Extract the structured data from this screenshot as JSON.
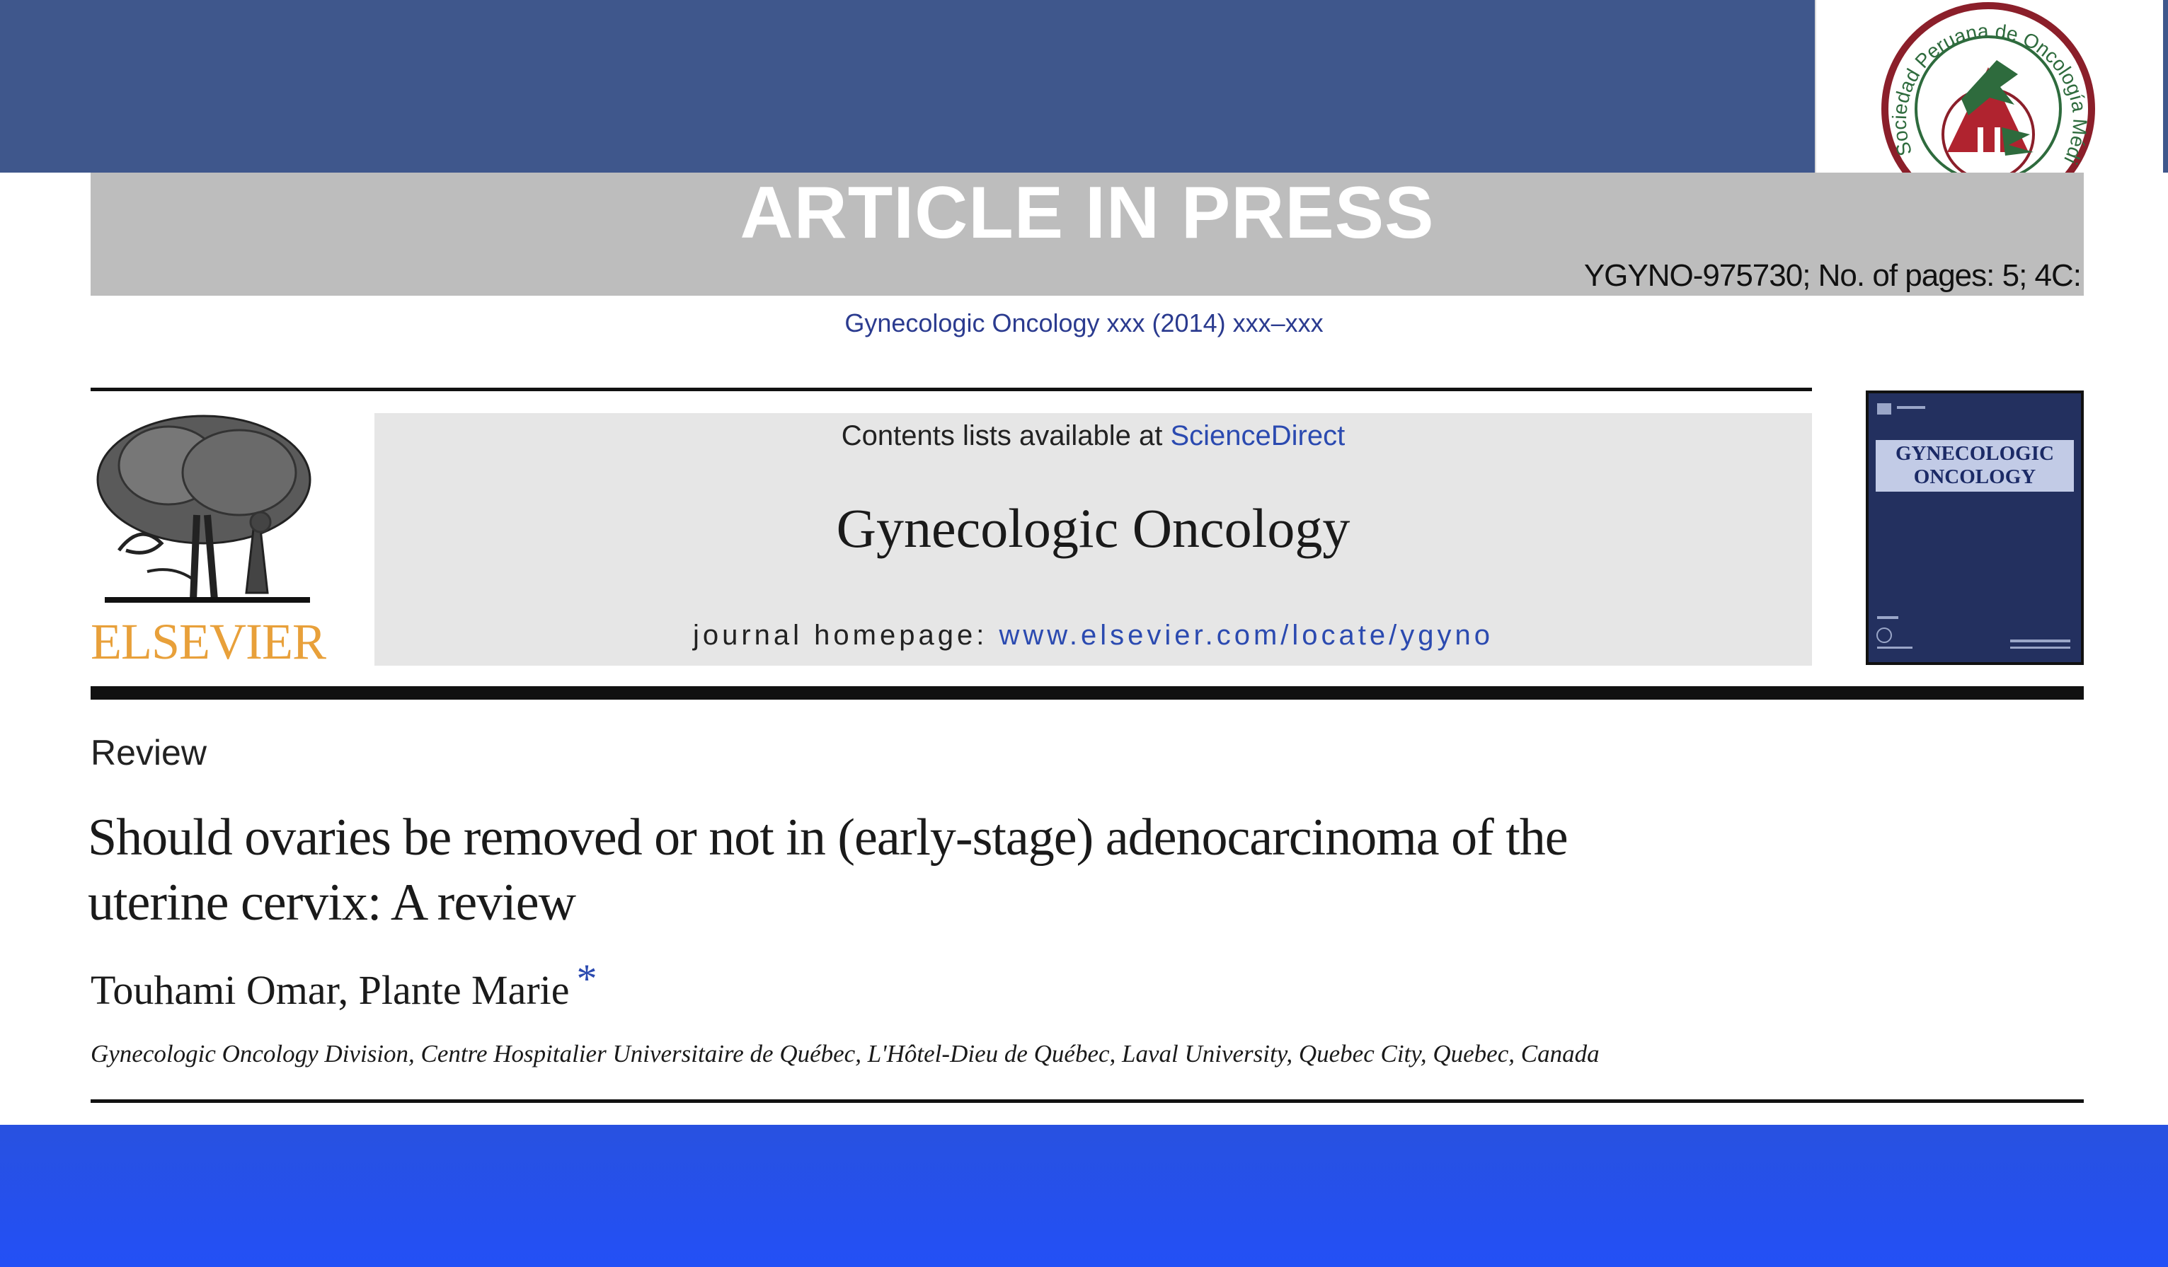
{
  "article_in_press": {
    "title": "ARTICLE IN PRESS",
    "reference": "YGYNO-975730; No. of pages: 5; 4C:"
  },
  "journal_ref": "Gynecologic Oncology xxx (2014) xxx–xxx",
  "society_logo": {
    "text": "Sociedad Peruana de Oncología Médica",
    "icon": "society-seal-icon"
  },
  "publisher": {
    "name": "ELSEVIER",
    "icon": "elsevier-tree-icon"
  },
  "masthead": {
    "contents_prefix": "Contents lists available at ",
    "contents_link": "ScienceDirect",
    "journal_title": "Gynecologic Oncology",
    "homepage_prefix": "journal homepage: ",
    "homepage_url": "www.elsevier.com/locate/ygyno"
  },
  "cover": {
    "title_line1": "GYNECOLOGIC",
    "title_line2": "ONCOLOGY"
  },
  "article": {
    "type": "Review",
    "title_line1": "Should ovaries be removed or not in (early-stage) adenocarcinoma of the",
    "title_line2": "uterine cervix: A review",
    "authors": "Touhami Omar, Plante Marie",
    "corresponding_mark": "*",
    "affiliation": "Gynecologic Oncology Division, Centre Hospitalier Universitaire de Québec, L'Hôtel-Dieu de Québec, Laval University, Quebec City, Quebec, Canada"
  },
  "colors": {
    "top_bar": "#3f578c",
    "bottom_bar": "#2350f6",
    "link_blue": "#2b4ab0",
    "elsevier_orange": "#e8a03a"
  }
}
